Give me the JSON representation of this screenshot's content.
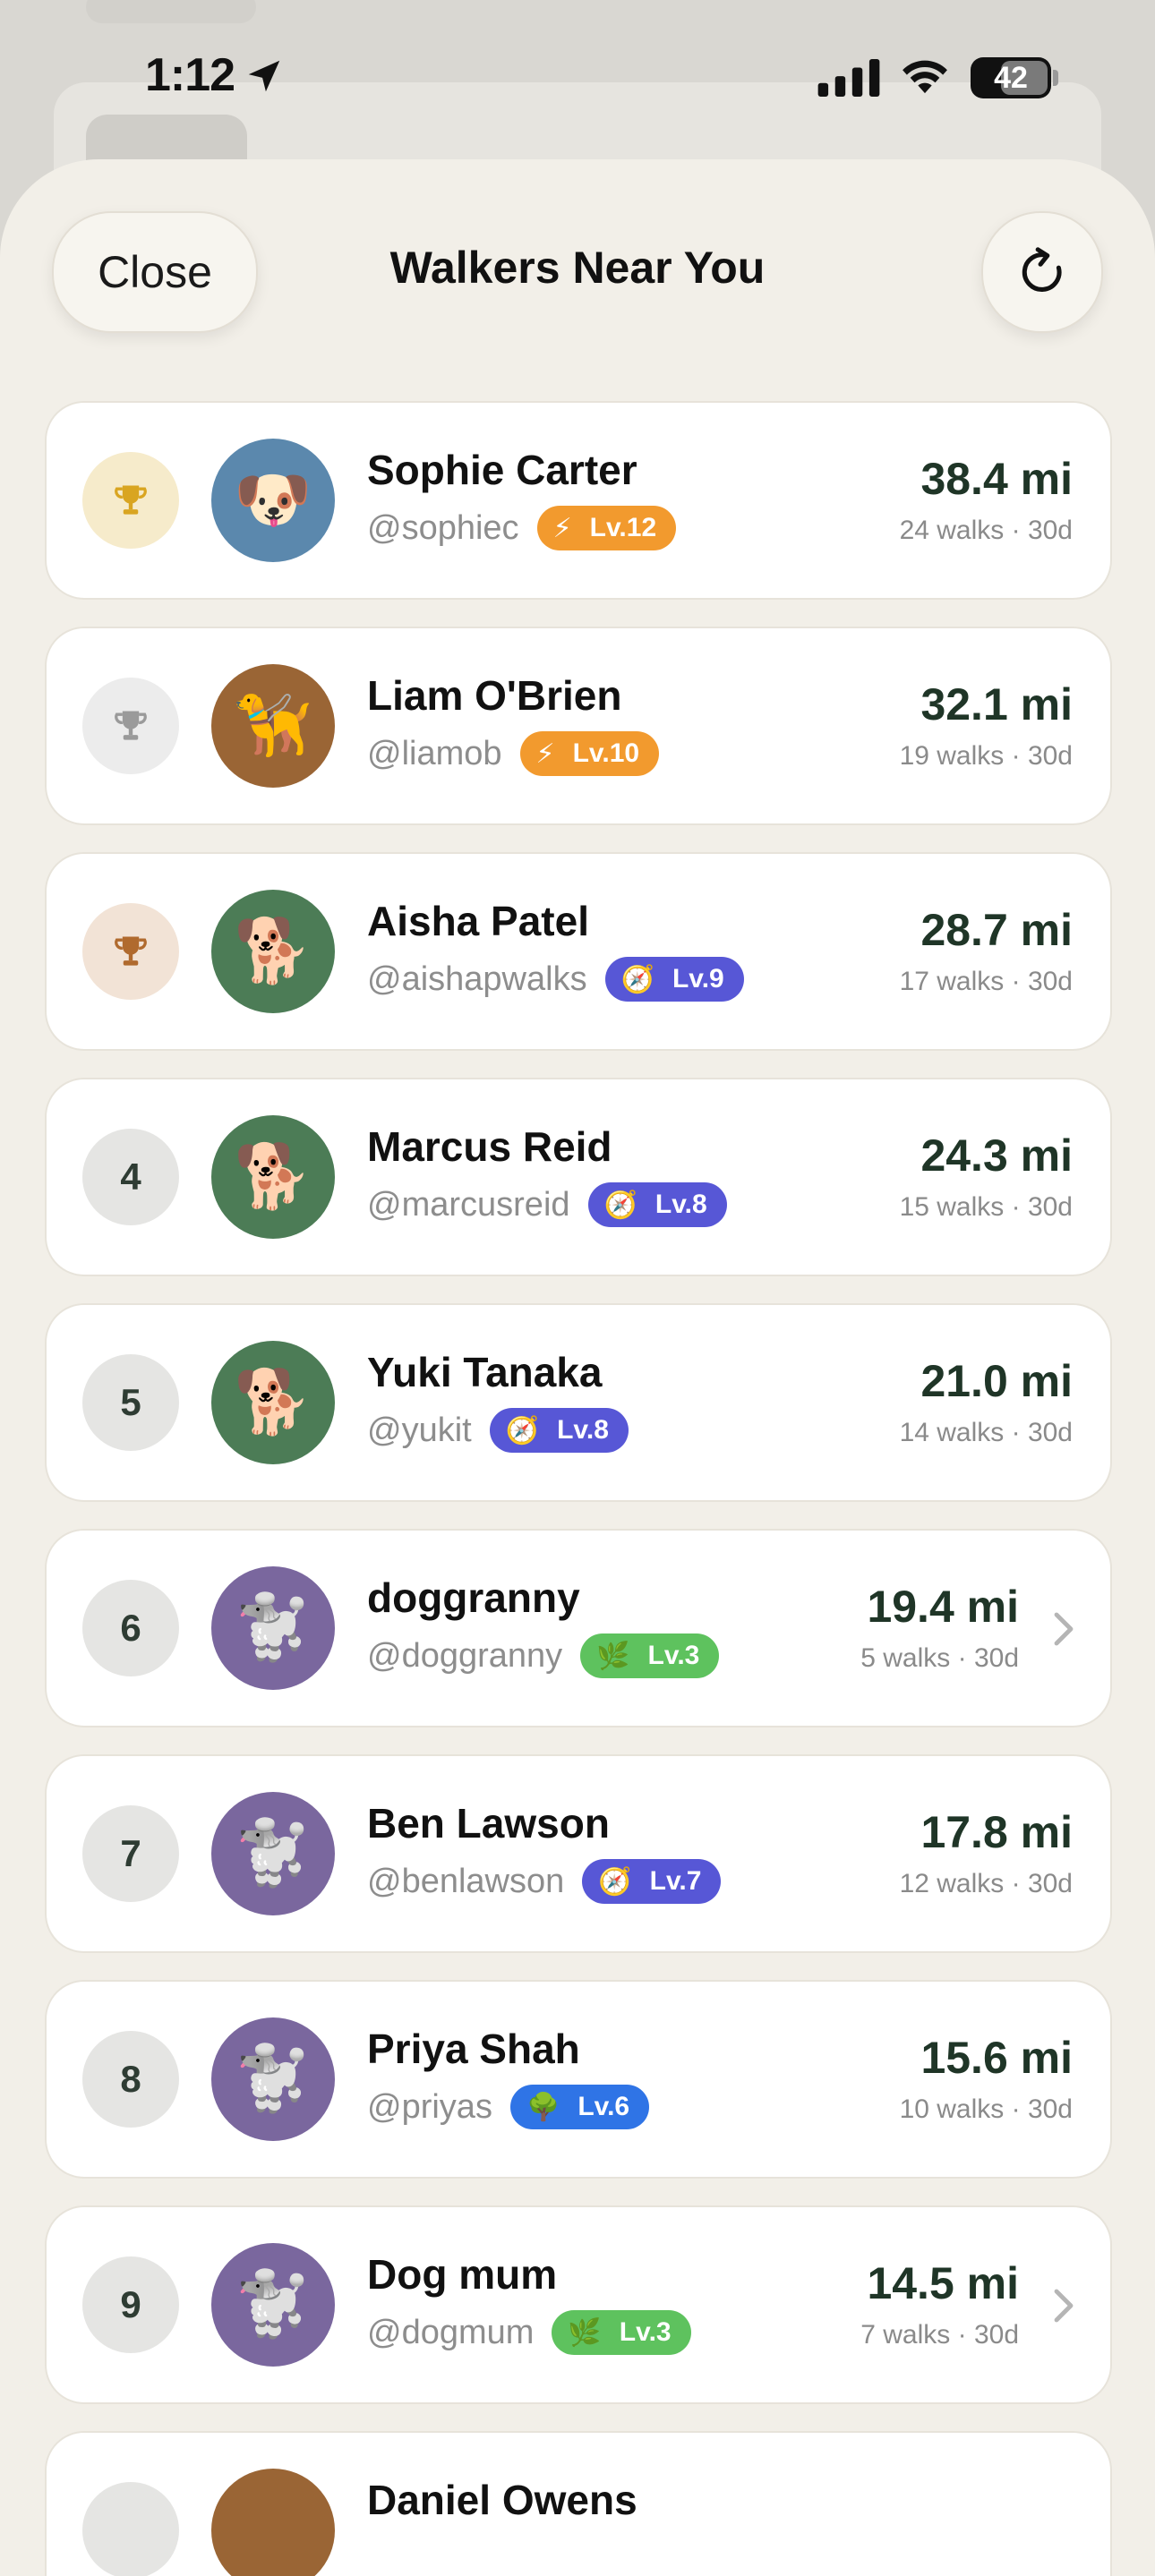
{
  "status_bar": {
    "time": "1:12",
    "battery": "42"
  },
  "header": {
    "close_label": "Close",
    "title": "Walkers Near You"
  },
  "colors": {
    "sheet_bg": "#f2efe8",
    "distance_text": "#1f3527",
    "badge_orange": "#f29a2e",
    "badge_indigo": "#5757d6",
    "badge_green": "#5ec25e",
    "badge_blue": "#2f74e6"
  },
  "walkers": [
    {
      "rank": "",
      "rank_icon": "trophy-gold-icon",
      "name": "Sophie Carter",
      "handle": "@sophiec",
      "badge_icon": "⚡",
      "badge_icon_name": "lightning-icon",
      "level": "Lv.12",
      "badge_color": "#f29a2e",
      "avatar_icon": "🐶",
      "avatar_color": "#5b88ad",
      "distance": "38.4 mi",
      "meta": "24 walks · 30d",
      "chevron": false
    },
    {
      "rank": "",
      "rank_icon": "trophy-silver-icon",
      "name": "Liam O'Brien",
      "handle": "@liamob",
      "badge_icon": "⚡",
      "badge_icon_name": "lightning-icon",
      "level": "Lv.10",
      "badge_color": "#f29a2e",
      "avatar_icon": "🦮",
      "avatar_color": "#9a6535",
      "distance": "32.1 mi",
      "meta": "19 walks · 30d",
      "chevron": false
    },
    {
      "rank": "",
      "rank_icon": "trophy-bronze-icon",
      "name": "Aisha Patel",
      "handle": "@aishapwalks",
      "badge_icon": "🧭",
      "badge_icon_name": "compass-icon",
      "level": "Lv.9",
      "badge_color": "#5757d6",
      "avatar_icon": "🐕",
      "avatar_color": "#4c7c56",
      "distance": "28.7 mi",
      "meta": "17 walks · 30d",
      "chevron": false
    },
    {
      "rank": "4",
      "rank_icon": "",
      "name": "Marcus Reid",
      "handle": "@marcusreid",
      "badge_icon": "🧭",
      "badge_icon_name": "compass-icon",
      "level": "Lv.8",
      "badge_color": "#5757d6",
      "avatar_icon": "🐕",
      "avatar_color": "#4c7c56",
      "distance": "24.3 mi",
      "meta": "15 walks · 30d",
      "chevron": false
    },
    {
      "rank": "5",
      "rank_icon": "",
      "name": "Yuki Tanaka",
      "handle": "@yukit",
      "badge_icon": "🧭",
      "badge_icon_name": "compass-icon",
      "level": "Lv.8",
      "badge_color": "#5757d6",
      "avatar_icon": "🐕",
      "avatar_color": "#4c7c56",
      "distance": "21.0 mi",
      "meta": "14 walks · 30d",
      "chevron": false
    },
    {
      "rank": "6",
      "rank_icon": "",
      "name": "doggranny",
      "handle": "@doggranny",
      "badge_icon": "🌿",
      "badge_icon_name": "herb-icon",
      "level": "Lv.3",
      "badge_color": "#5ec25e",
      "avatar_icon": "🐩",
      "avatar_color": "#7a679e",
      "distance": "19.4 mi",
      "meta": "5 walks · 30d",
      "chevron": true
    },
    {
      "rank": "7",
      "rank_icon": "",
      "name": "Ben Lawson",
      "handle": "@benlawson",
      "badge_icon": "🧭",
      "badge_icon_name": "compass-icon",
      "level": "Lv.7",
      "badge_color": "#5757d6",
      "avatar_icon": "🐩",
      "avatar_color": "#7a679e",
      "distance": "17.8 mi",
      "meta": "12 walks · 30d",
      "chevron": false
    },
    {
      "rank": "8",
      "rank_icon": "",
      "name": "Priya Shah",
      "handle": "@priyas",
      "badge_icon": "🌳",
      "badge_icon_name": "tree-icon",
      "level": "Lv.6",
      "badge_color": "#2f74e6",
      "avatar_icon": "🐩",
      "avatar_color": "#7a679e",
      "distance": "15.6 mi",
      "meta": "10 walks · 30d",
      "chevron": false
    },
    {
      "rank": "9",
      "rank_icon": "",
      "name": "Dog mum",
      "handle": "@dogmum",
      "badge_icon": "🌿",
      "badge_icon_name": "herb-icon",
      "level": "Lv.3",
      "badge_color": "#5ec25e",
      "avatar_icon": "🐩",
      "avatar_color": "#7a679e",
      "distance": "14.5 mi",
      "meta": "7 walks · 30d",
      "chevron": true
    },
    {
      "rank": "",
      "rank_icon": "",
      "name": "Daniel Owens",
      "handle": "",
      "badge_icon": "",
      "badge_icon_name": "",
      "level": "",
      "badge_color": "#f29a2e",
      "avatar_icon": "",
      "avatar_color": "#9a6535",
      "distance": "",
      "meta": "",
      "chevron": false
    }
  ]
}
